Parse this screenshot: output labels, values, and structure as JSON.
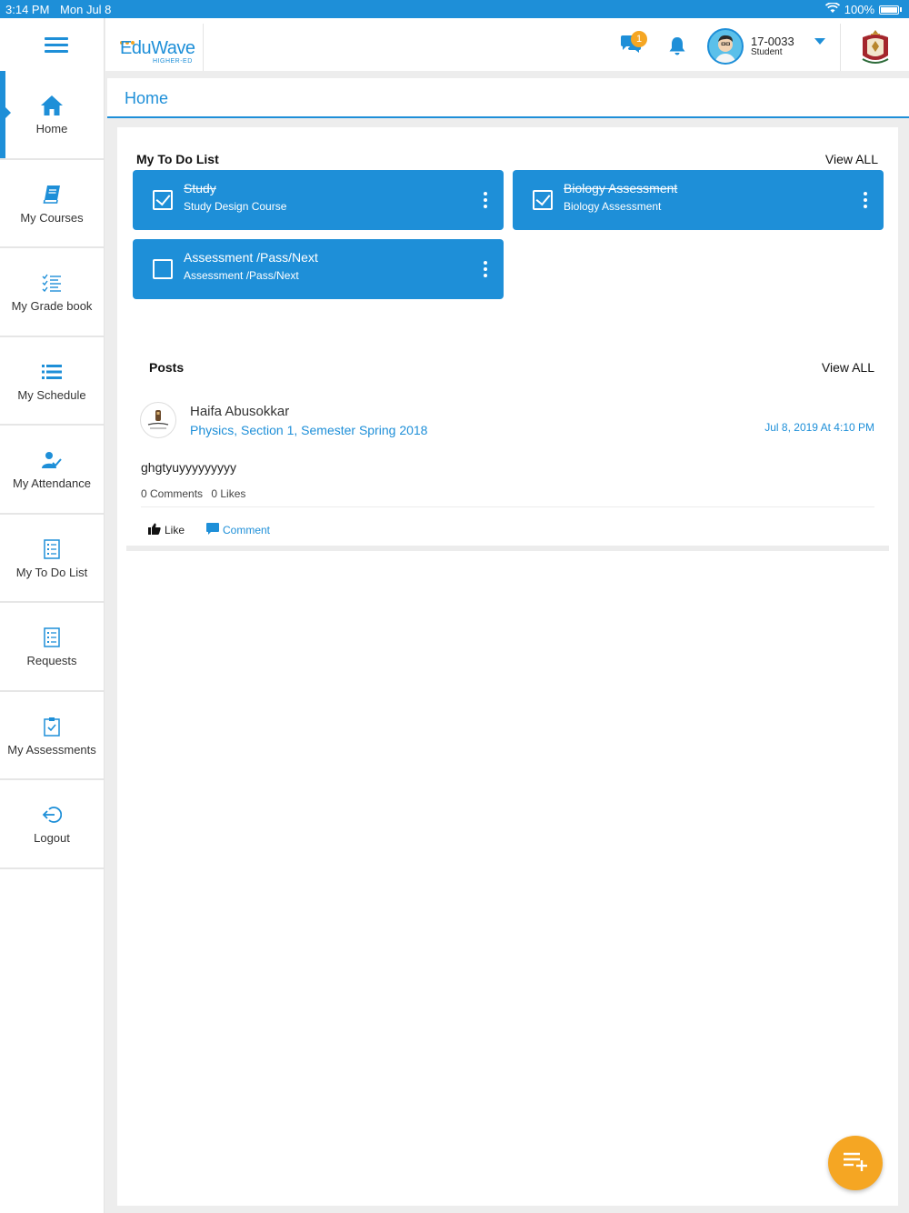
{
  "status_bar": {
    "time": "3:14 PM",
    "date": "Mon Jul 8",
    "battery": "100%"
  },
  "header": {
    "logo_text": "Edu",
    "logo_text_b": "Wave",
    "logo_sub": "HIGHER-ED",
    "chat_badge": "1",
    "user_id": "17-0033",
    "user_role": "Student"
  },
  "sidebar": {
    "items": [
      {
        "label": "Home",
        "icon": "home-icon"
      },
      {
        "label": "My Courses",
        "icon": "book-icon"
      },
      {
        "label": "My Grade book",
        "icon": "gradebook-icon"
      },
      {
        "label": "My Schedule",
        "icon": "schedule-icon"
      },
      {
        "label": "My Attendance",
        "icon": "attendance-icon"
      },
      {
        "label": "My To Do List",
        "icon": "todo-icon"
      },
      {
        "label": "Requests",
        "icon": "requests-icon"
      },
      {
        "label": "My Assessments",
        "icon": "assessment-icon"
      },
      {
        "label": "Logout",
        "icon": "logout-icon"
      }
    ]
  },
  "page": {
    "title": "Home"
  },
  "todo": {
    "title": "My To Do List",
    "view_all": "View ALL",
    "items": [
      {
        "title": "Study",
        "subtitle": "Study Design Course",
        "done": true
      },
      {
        "title": "Biology Assessment",
        "subtitle": "Biology Assessment",
        "done": true
      },
      {
        "title": "Assessment /Pass/Next",
        "subtitle": "Assessment /Pass/Next",
        "done": false
      }
    ]
  },
  "posts": {
    "title": "Posts",
    "view_all": "View ALL",
    "items": [
      {
        "author": "Haifa Abusokkar",
        "course": "Physics, Section 1, Semester Spring  2018",
        "date": "Jul 8, 2019 At 4:10 PM",
        "body": "ghgtyuyyyyyyyyy",
        "comments": "0 Comments",
        "likes": "0 Likes",
        "like_label": "Like",
        "comment_label": "Comment"
      }
    ]
  },
  "colors": {
    "primary": "#1e8fd8",
    "accent": "#f5a623"
  }
}
